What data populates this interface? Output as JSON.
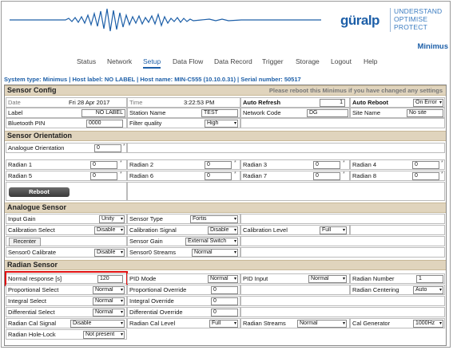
{
  "header": {
    "logo": "güralp",
    "tagline": [
      "UNDERSTAND",
      "OPTIMISE",
      "PROTECT"
    ],
    "device_name": "Minimus"
  },
  "nav": [
    "Status",
    "Network",
    "Setup",
    "Data Flow",
    "Data Record",
    "Trigger",
    "Storage",
    "Logout",
    "Help"
  ],
  "nav_active": "Setup",
  "system_line": "System type: Minimus | Host label: NO LABEL | Host name: MIN-C555 (10.10.0.31) | Serial number: 50517",
  "sensor_config": {
    "title": "Sensor Config",
    "notice": "Please reboot this Minimus if you have changed any settings",
    "date_label": "Date",
    "date_value": "Fri 28 Apr 2017",
    "time_label": "Time",
    "time_value": "3:22:53 PM",
    "auto_refresh_label": "Auto Refresh",
    "auto_refresh_value": "1",
    "auto_reboot_label": "Auto Reboot",
    "auto_reboot_value": "On Error",
    "label_label": "Label",
    "label_value": "NO LABEL",
    "station_label": "Station Name",
    "station_value": "TEST",
    "network_label": "Network Code",
    "network_value": "DG",
    "site_label": "Site Name",
    "site_value": "No site",
    "bt_label": "Bluetooth PIN",
    "bt_value": "0000",
    "filter_label": "Filter quality",
    "filter_value": "High"
  },
  "sensor_orientation": {
    "title": "Sensor Orientation",
    "analogue_label": "Analogue Orientation",
    "analogue_value": "0",
    "radians": [
      {
        "label": "Radian 1",
        "value": "0"
      },
      {
        "label": "Radian 2",
        "value": "0"
      },
      {
        "label": "Radian 3",
        "value": "0"
      },
      {
        "label": "Radian 4",
        "value": "0"
      },
      {
        "label": "Radian 5",
        "value": "0"
      },
      {
        "label": "Radian 6",
        "value": "0"
      },
      {
        "label": "Radian 7",
        "value": "0"
      },
      {
        "label": "Radian 8",
        "value": "0"
      }
    ],
    "star": "*",
    "reboot_label": "Reboot"
  },
  "analogue_sensor": {
    "title": "Analogue Sensor",
    "input_gain_label": "Input Gain",
    "input_gain_value": "Unity",
    "sensor_type_label": "Sensor Type",
    "sensor_type_value": "Fortis",
    "cal_select_label": "Calibration Select",
    "cal_select_value": "Disable",
    "cal_signal_label": "Calibration Signal",
    "cal_signal_value": "Disable",
    "cal_level_label": "Calibration Level",
    "cal_level_value": "Full",
    "recenter_label": "Recenter",
    "sensor_gain_label": "Sensor Gain",
    "sensor_gain_value": "External Switch",
    "s0_calibrate_label": "Sensor0 Calibrate",
    "s0_calibrate_value": "Disable",
    "s0_streams_label": "Sensor0 Streams",
    "s0_streams_value": "Normal"
  },
  "radian_sensor": {
    "title": "Radian Sensor",
    "normal_response_label": "Normal response [s]",
    "normal_response_value": "120",
    "pid_mode_label": "PID Mode",
    "pid_mode_value": "Normal",
    "pid_input_label": "PID Input",
    "pid_input_value": "Normal",
    "radian_number_label": "Radian Number",
    "radian_number_value": "1",
    "prop_select_label": "Proportional Select",
    "prop_select_value": "Normal",
    "prop_override_label": "Proportional Override",
    "prop_override_value": "0",
    "radian_centering_label": "Radian Centering",
    "radian_centering_value": "Auto",
    "int_select_label": "Integral Select",
    "int_select_value": "Normal",
    "int_override_label": "Integral Override",
    "int_override_value": "0",
    "diff_select_label": "Differential Select",
    "diff_select_value": "Normal",
    "diff_override_label": "Differential Override",
    "diff_override_value": "0",
    "cal_signal_label": "Radian Cal Signal",
    "cal_signal_value": "Disable",
    "cal_level_label": "Radian Cal Level",
    "cal_level_value": "Full",
    "streams_label": "Radian Streams",
    "streams_value": "Normal",
    "cal_gen_label": "Cal Generator",
    "cal_gen_value": "1000Hz",
    "hole_lock_label": "Radian Hole-Lock",
    "hole_lock_value": "Not present"
  },
  "colors": {
    "brand_blue": "#1d5fa8",
    "section_bg": "#e0d4bd",
    "highlight_red": "#e01010"
  }
}
